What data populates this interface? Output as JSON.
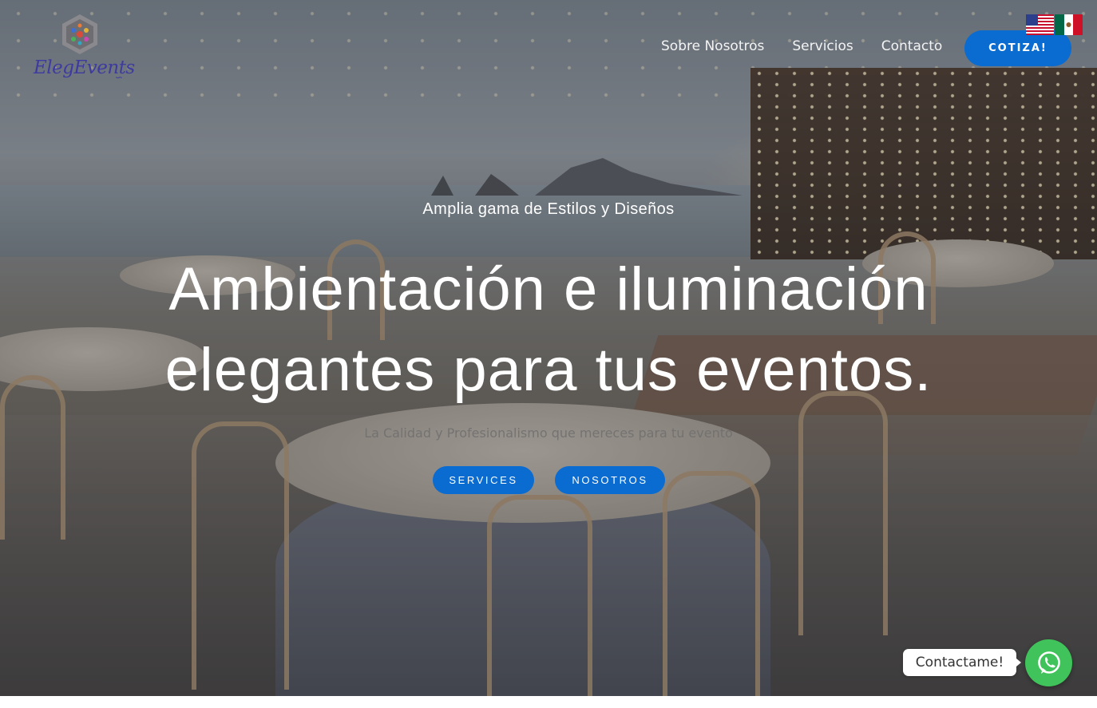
{
  "brand": {
    "logo_text": "ElegEvents"
  },
  "nav": {
    "items": [
      {
        "label": "Sobre Nosotros"
      },
      {
        "label": "Servicios"
      },
      {
        "label": "Contacto"
      }
    ],
    "cta_label": "COTIZA!"
  },
  "language": {
    "flags": [
      {
        "icon": "us-flag-icon"
      },
      {
        "icon": "mexico-flag-icon"
      }
    ]
  },
  "hero": {
    "kicker": "Amplia gama de Estilos y Diseños",
    "headline_line1": "Ambientación e iluminación",
    "headline_line2": "elegantes para tus eventos.",
    "tagline": "La Calidad y Profesionalismo que mereces para tu evento",
    "buttons": [
      {
        "label": "SERVICES"
      },
      {
        "label": "NOSOTROS"
      }
    ]
  },
  "whatsapp": {
    "label": "Contactame!",
    "icon": "whatsapp-icon"
  },
  "colors": {
    "accent": "#0a6bd1",
    "whatsapp": "#3fc35a",
    "logo": "#3d3aa0"
  }
}
